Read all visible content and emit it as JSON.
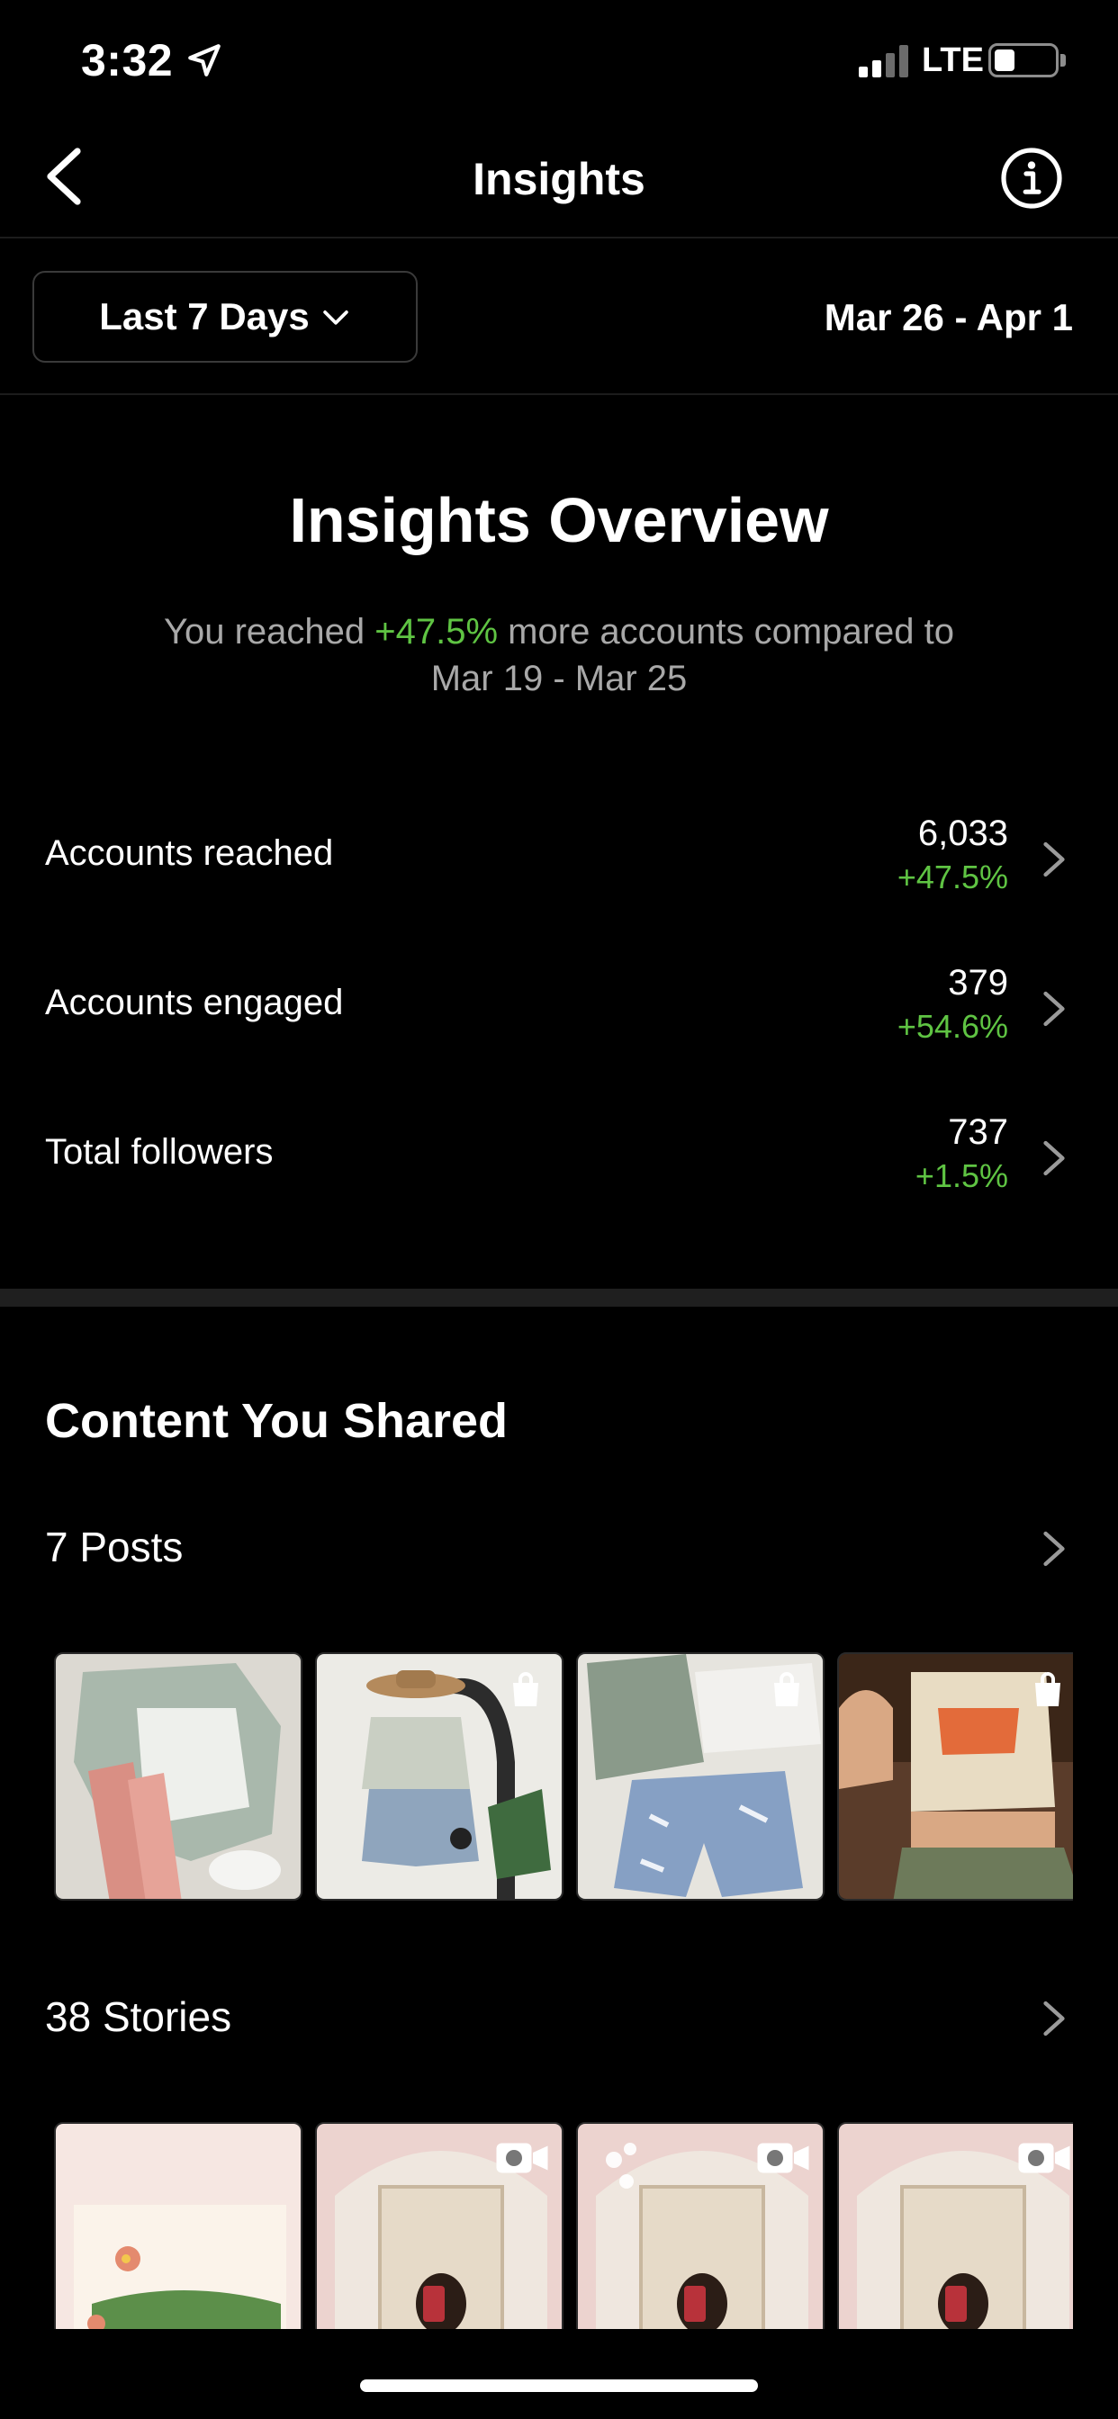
{
  "status_bar": {
    "time": "3:32",
    "network": "LTE",
    "battery_level": 0.25
  },
  "nav": {
    "title": "Insights"
  },
  "filter": {
    "range_label": "Last 7 Days",
    "date_range": "Mar 26 - Apr 1"
  },
  "overview": {
    "title": "Insights Overview",
    "subtitle_prefix": "You reached ",
    "subtitle_change": "+47.5%",
    "subtitle_suffix": " more accounts compared to",
    "subtitle_line2": "Mar 19 - Mar 25"
  },
  "metrics": [
    {
      "label": "Accounts reached",
      "value": "6,033",
      "delta": "+47.5%"
    },
    {
      "label": "Accounts engaged",
      "value": "379",
      "delta": "+54.6%"
    },
    {
      "label": "Total followers",
      "value": "737",
      "delta": "+1.5%"
    }
  ],
  "content": {
    "title": "Content You Shared",
    "posts_label": "7 Posts",
    "stories_label": "38 Stories"
  },
  "colors": {
    "positive": "#5fc443",
    "background": "#000000",
    "muted_text": "#a8a8a8"
  },
  "icons": {
    "location": "location-arrow-icon",
    "back": "chevron-left-icon",
    "info": "info-circle-icon",
    "dropdown": "chevron-down-icon",
    "row": "chevron-right-icon",
    "shopping": "shopping-bag-icon",
    "video": "video-camera-icon"
  }
}
